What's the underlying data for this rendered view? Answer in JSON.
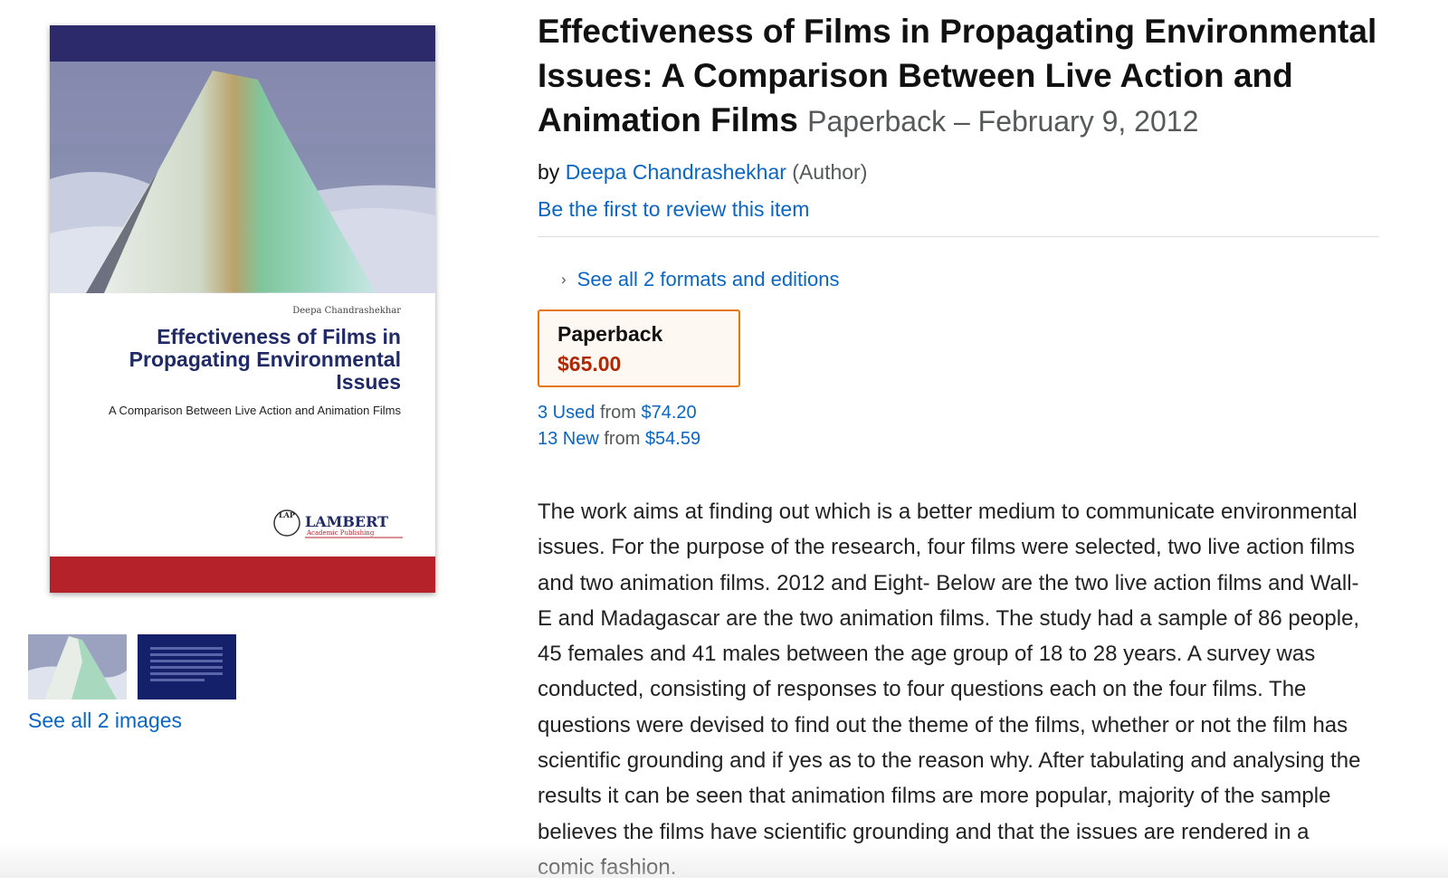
{
  "cover": {
    "author": "Deepa Chandrashekhar",
    "title": "Effectiveness of Films in Propagating Environmental Issues",
    "subtitle": "A Comparison Between Live Action and Animation Films",
    "publisher_mark": "LAP",
    "publisher_name": "LAMBERT",
    "publisher_tagline": "Academic Publishing",
    "colors": {
      "top_band": "#2c2a6b",
      "bottom_band": "#b5222a",
      "title": "#1f2a66"
    }
  },
  "thumbnails": [
    {
      "icon": "cover-photo-thumbnail"
    },
    {
      "icon": "back-cover-thumbnail"
    }
  ],
  "see_all_images": "See all 2 images",
  "product": {
    "title": "Effectiveness of Films in Propagating Environmental Issues: A Comparison Between Live Action and Animation Films",
    "format_date": "Paperback – February 9, 2012",
    "by": "by",
    "author": "Deepa Chandrashekhar",
    "role": "(Author)",
    "review_link": "Be the first to review this item",
    "formats_link": "See all 2 formats and editions",
    "format_box": {
      "format": "Paperback",
      "price": "$65.00"
    },
    "offers": [
      {
        "count": "3 Used",
        "from": "from",
        "price": "$74.20"
      },
      {
        "count": "13 New",
        "from": "from",
        "price": "$54.59"
      }
    ],
    "description": "The work aims at finding out which is a better medium to communicate environmental issues. For the purpose of the research, four films were selected, two live action films and two animation films. 2012 and Eight- Below are the two live action films and Wall-E and Madagascar are the two animation films. The study had a sample of 86 people, 45 females and 41 males between the age group of 18 to 28 years. A survey was conducted, consisting of responses to four questions each on the four films. The questions were devised to find out the theme of the films, whether or not the film has scientific grounding and if yes as to the reason why. After tabulating and analysing the results it can be seen that animation films are more popular, majority of the sample believes the films have scientific grounding and that the issues are rendered in a comic fashion."
  },
  "colors": {
    "link": "#0a66c2",
    "price": "#b12704",
    "format_border": "#e77600",
    "muted": "#565959"
  }
}
